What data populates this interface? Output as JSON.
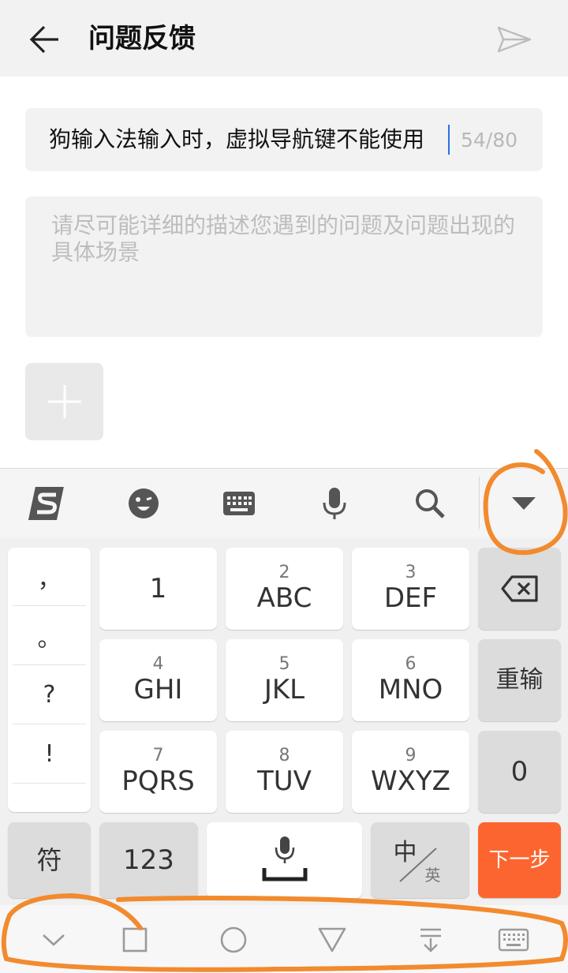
{
  "header": {
    "title": "问题反馈"
  },
  "form": {
    "subject_value": "狗输入法输入时，虚拟导航键不能使用",
    "subject_counter": "54/80",
    "description_placeholder": "请尽可能详细的描述您遇到的问题及问题出现的具体场景"
  },
  "keyboard": {
    "toolbar_icons": [
      "sogou-logo-icon",
      "emoji-icon",
      "keyboard-icon",
      "microphone-icon",
      "search-icon",
      "collapse-icon"
    ],
    "punctuation": [
      "，",
      "。",
      "?",
      "!"
    ],
    "keys": {
      "k1": {
        "num": "",
        "label": "1"
      },
      "k2": {
        "num": "2",
        "label": "ABC"
      },
      "k3": {
        "num": "3",
        "label": "DEF"
      },
      "k4": {
        "num": "4",
        "label": "GHI"
      },
      "k5": {
        "num": "5",
        "label": "JKL"
      },
      "k6": {
        "num": "6",
        "label": "MNO"
      },
      "k7": {
        "num": "7",
        "label": "PQRS"
      },
      "k8": {
        "num": "8",
        "label": "TUV"
      },
      "k9": {
        "num": "9",
        "label": "WXYZ"
      }
    },
    "reinput": "重输",
    "zero": "0",
    "symbols": "符",
    "numbers": "123",
    "lang_top": "中",
    "lang_bottom": "英",
    "next": "下一步",
    "accent": "#fd6530"
  },
  "navbar": {
    "icons": [
      "chevron-down-icon",
      "square-icon",
      "circle-icon",
      "triangle-back-icon",
      "pull-down-icon",
      "keyboard-icon"
    ]
  },
  "annotation_color": "#f28a2e"
}
